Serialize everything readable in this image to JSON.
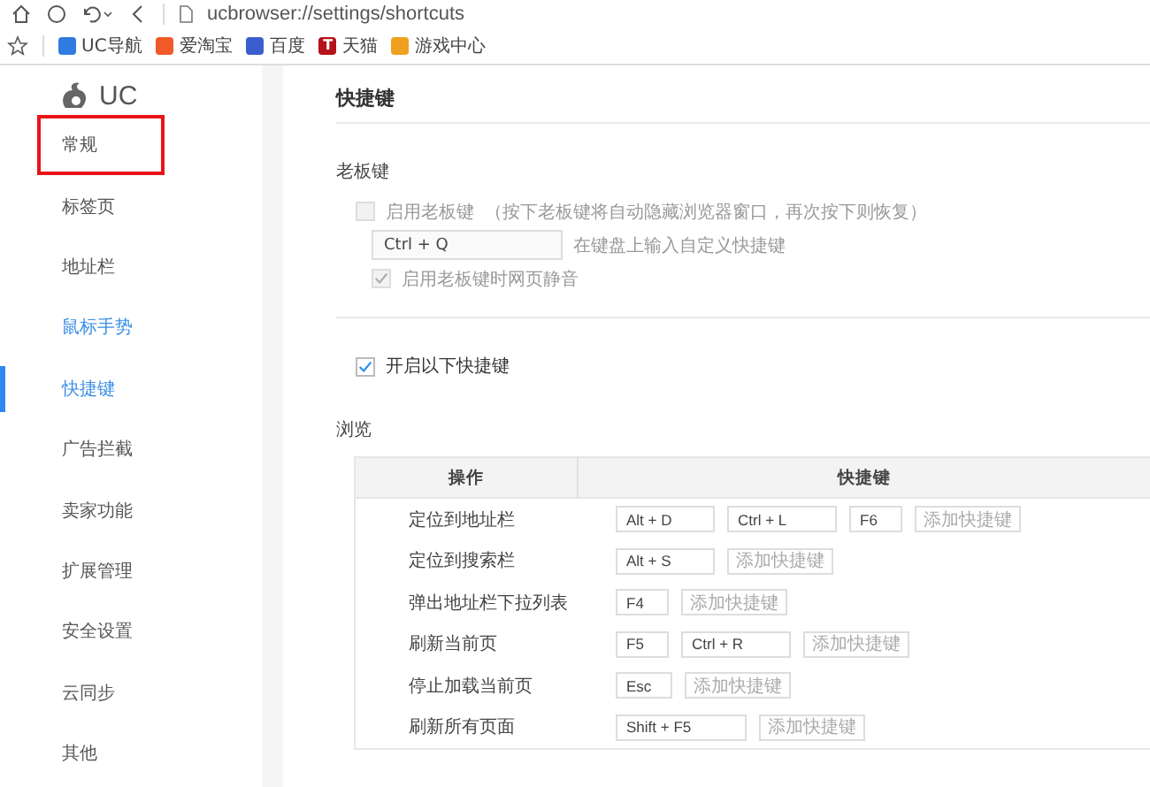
{
  "toolbar": {
    "url": "ucbrowser://settings/shortcuts"
  },
  "bookmarks": [
    {
      "label": "UC导航",
      "color": "#2f7be0"
    },
    {
      "label": "爱淘宝",
      "color": "#f05a28"
    },
    {
      "label": "百度",
      "color": "#3a5fcd"
    },
    {
      "label": "天猫",
      "color": "#b5121b",
      "icon_text": "T"
    },
    {
      "label": "游戏中心",
      "color": "#f0a020"
    }
  ],
  "sidebar": {
    "logo": "UC",
    "items": [
      {
        "label": "常规",
        "selected": false,
        "hovered": false,
        "annotated": true
      },
      {
        "label": "标签页",
        "selected": false,
        "hovered": false,
        "annotated": false
      },
      {
        "label": "地址栏",
        "selected": false,
        "hovered": false,
        "annotated": false
      },
      {
        "label": "鼠标手势",
        "selected": false,
        "hovered": true,
        "annotated": false
      },
      {
        "label": "快捷键",
        "selected": true,
        "hovered": false,
        "annotated": false
      },
      {
        "label": "广告拦截",
        "selected": false,
        "hovered": false,
        "annotated": false
      },
      {
        "label": "卖家功能",
        "selected": false,
        "hovered": false,
        "annotated": false
      },
      {
        "label": "扩展管理",
        "selected": false,
        "hovered": false,
        "annotated": false
      },
      {
        "label": "安全设置",
        "selected": false,
        "hovered": false,
        "annotated": false
      },
      {
        "label": "云同步",
        "selected": false,
        "hovered": false,
        "annotated": false
      },
      {
        "label": "其他",
        "selected": false,
        "hovered": false,
        "annotated": false
      }
    ]
  },
  "content": {
    "title": "快捷键",
    "boss_key": {
      "heading": "老板键",
      "enable": {
        "label": "启用老板键",
        "note": "（按下老板键将自动隐藏浏览器窗口，再次按下则恢复）",
        "checked": false,
        "disabled": true
      },
      "key_field": "Ctrl + Q",
      "hint": "在键盘上输入自定义快捷键",
      "mute": {
        "label": "启用老板键时网页静音",
        "checked": true,
        "disabled": true
      }
    },
    "enable_shortcuts": {
      "label": "开启以下快捷键",
      "checked": true,
      "disabled": false
    },
    "browse": {
      "heading": "浏览",
      "columns": [
        "操作",
        "快捷键"
      ],
      "rows": [
        {
          "action": "定位到地址栏",
          "keys": [
            "Alt + D",
            "Ctrl + L",
            "F6"
          ],
          "add_label": "添加快捷键"
        },
        {
          "action": "定位到搜索栏",
          "keys": [
            "Alt + S"
          ],
          "add_label": "添加快捷键"
        },
        {
          "action": "弹出地址栏下拉列表",
          "keys": [
            "F4"
          ],
          "add_label": "添加快捷键"
        },
        {
          "action": "刷新当前页",
          "keys": [
            "F5",
            "Ctrl + R"
          ],
          "add_label": "添加快捷键"
        },
        {
          "action": "停止加载当前页",
          "keys": [
            "Esc"
          ],
          "add_label": "添加快捷键"
        },
        {
          "action": "刷新所有页面",
          "keys": [
            "Shift + F5"
          ],
          "add_label": "添加快捷键"
        }
      ]
    }
  }
}
